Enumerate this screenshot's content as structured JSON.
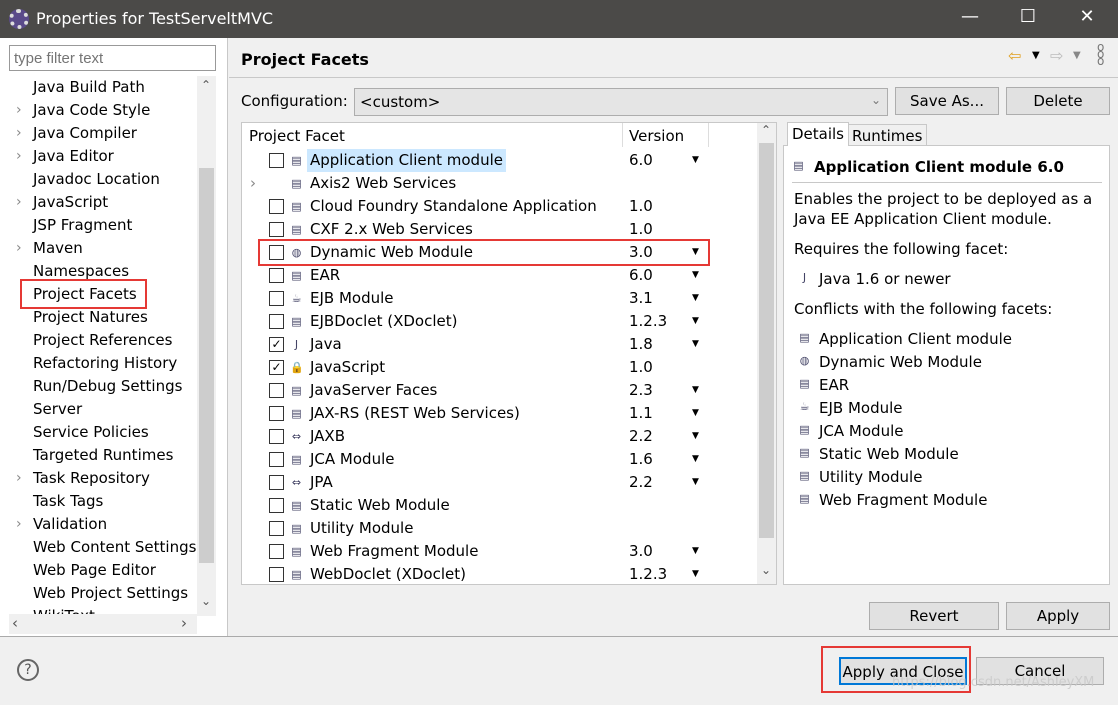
{
  "window": {
    "title": "Properties for TestServeltMVC",
    "minimize": "—",
    "maximize": "☐",
    "close": "✕"
  },
  "sidebar": {
    "filter_placeholder": "type filter text",
    "items": [
      {
        "label": "Java Build Path",
        "expandable": false
      },
      {
        "label": "Java Code Style",
        "expandable": true
      },
      {
        "label": "Java Compiler",
        "expandable": true
      },
      {
        "label": "Java Editor",
        "expandable": true
      },
      {
        "label": "Javadoc Location",
        "expandable": false
      },
      {
        "label": "JavaScript",
        "expandable": true
      },
      {
        "label": "JSP Fragment",
        "expandable": false
      },
      {
        "label": "Maven",
        "expandable": true
      },
      {
        "label": "Namespaces",
        "expandable": false
      },
      {
        "label": "Project Facets",
        "expandable": false,
        "selected": true
      },
      {
        "label": "Project Natures",
        "expandable": false
      },
      {
        "label": "Project References",
        "expandable": false
      },
      {
        "label": "Refactoring History",
        "expandable": false
      },
      {
        "label": "Run/Debug Settings",
        "expandable": false
      },
      {
        "label": "Server",
        "expandable": false
      },
      {
        "label": "Service Policies",
        "expandable": false
      },
      {
        "label": "Targeted Runtimes",
        "expandable": false
      },
      {
        "label": "Task Repository",
        "expandable": true
      },
      {
        "label": "Task Tags",
        "expandable": false
      },
      {
        "label": "Validation",
        "expandable": true
      },
      {
        "label": "Web Content Settings",
        "expandable": false
      },
      {
        "label": "Web Page Editor",
        "expandable": false
      },
      {
        "label": "Web Project Settings",
        "expandable": false
      },
      {
        "label": "WikiText",
        "expandable": false
      }
    ]
  },
  "page": {
    "title": "Project Facets",
    "configuration_label": "Configuration:",
    "configuration_value": "<custom>",
    "save_as": "Save As...",
    "delete": "Delete",
    "columns": {
      "facet": "Project Facet",
      "version": "Version"
    },
    "facets": [
      {
        "name": "Application Client module",
        "version": "6.0",
        "checked": false,
        "dropdown": true,
        "icon": "doc",
        "selected": true
      },
      {
        "name": "Axis2 Web Services",
        "version": "",
        "checked": false,
        "dropdown": false,
        "icon": "doc",
        "expandable": true
      },
      {
        "name": "Cloud Foundry Standalone Application",
        "version": "1.0",
        "checked": false,
        "dropdown": false,
        "icon": "doc"
      },
      {
        "name": "CXF 2.x Web Services",
        "version": "1.0",
        "checked": false,
        "dropdown": false,
        "icon": "doc"
      },
      {
        "name": "Dynamic Web Module",
        "version": "3.0",
        "checked": false,
        "dropdown": true,
        "icon": "globe",
        "highlight": true
      },
      {
        "name": "EAR",
        "version": "6.0",
        "checked": false,
        "dropdown": true,
        "icon": "doc"
      },
      {
        "name": "EJB Module",
        "version": "3.1",
        "checked": false,
        "dropdown": true,
        "icon": "bean"
      },
      {
        "name": "EJBDoclet (XDoclet)",
        "version": "1.2.3",
        "checked": false,
        "dropdown": true,
        "icon": "doc"
      },
      {
        "name": "Java",
        "version": "1.8",
        "checked": true,
        "dropdown": true,
        "icon": "java"
      },
      {
        "name": "JavaScript",
        "version": "1.0",
        "checked": true,
        "dropdown": false,
        "icon": "lock"
      },
      {
        "name": "JavaServer Faces",
        "version": "2.3",
        "checked": false,
        "dropdown": true,
        "icon": "doc"
      },
      {
        "name": "JAX-RS (REST Web Services)",
        "version": "1.1",
        "checked": false,
        "dropdown": true,
        "icon": "doc"
      },
      {
        "name": "JAXB",
        "version": "2.2",
        "checked": false,
        "dropdown": true,
        "icon": "arrows"
      },
      {
        "name": "JCA Module",
        "version": "1.6",
        "checked": false,
        "dropdown": true,
        "icon": "doc"
      },
      {
        "name": "JPA",
        "version": "2.2",
        "checked": false,
        "dropdown": true,
        "icon": "arrows"
      },
      {
        "name": "Static Web Module",
        "version": "",
        "checked": false,
        "dropdown": false,
        "icon": "doc"
      },
      {
        "name": "Utility Module",
        "version": "",
        "checked": false,
        "dropdown": false,
        "icon": "doc"
      },
      {
        "name": "Web Fragment Module",
        "version": "3.0",
        "checked": false,
        "dropdown": true,
        "icon": "doc"
      },
      {
        "name": "WebDoclet (XDoclet)",
        "version": "1.2.3",
        "checked": false,
        "dropdown": true,
        "icon": "doc"
      }
    ],
    "details": {
      "tabs": [
        "Details",
        "Runtimes"
      ],
      "heading": "Application Client module 6.0",
      "description": [
        "Enables the project to be deployed as a",
        "Java EE Application Client module."
      ],
      "requires_label": "Requires the following facet:",
      "requires": "Java 1.6 or newer",
      "conflicts_label": "Conflicts with the following facets:",
      "conflicts": [
        "Application Client module",
        "Dynamic Web Module",
        "EAR",
        "EJB Module",
        "JCA Module",
        "Static Web Module",
        "Utility Module",
        "Web Fragment Module"
      ]
    },
    "revert": "Revert",
    "apply": "Apply"
  },
  "footer": {
    "help": "?",
    "apply_close": "Apply and Close",
    "cancel": "Cancel",
    "watermark": "https://blog.csdn.net/AshleyXM"
  },
  "colors": {
    "highlight": "#e53935",
    "selection": "#cce8ff",
    "focus": "#0078d7"
  }
}
